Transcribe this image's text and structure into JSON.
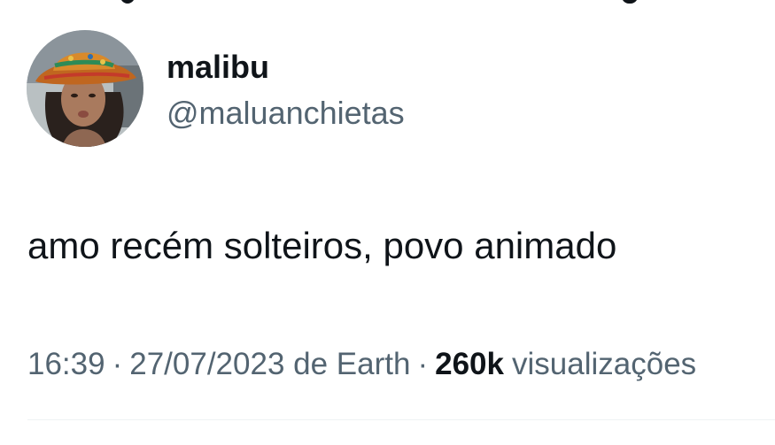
{
  "author": {
    "display_name": "malibu",
    "handle": "@maluanchietas",
    "avatar_icon": "profile-photo"
  },
  "tweet": {
    "text": "amo recém solteiros, povo animado"
  },
  "meta": {
    "time": "16:39",
    "separator": "·",
    "date": "27/07/2023",
    "source": "de Earth",
    "views_count": "260k",
    "views_label": "visualizações"
  },
  "colors": {
    "primary_text": "#0f1419",
    "secondary_text": "#536471",
    "divider": "#eff3f4",
    "background": "#ffffff"
  }
}
